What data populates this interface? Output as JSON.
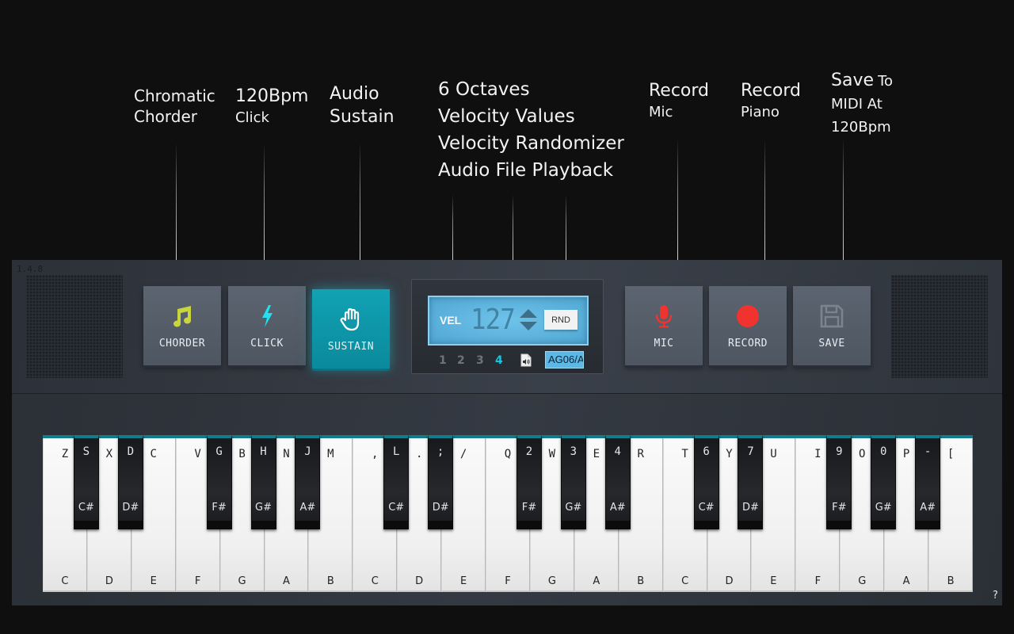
{
  "annotations": {
    "chorder": {
      "line1": "Chromatic",
      "line2": "Chorder"
    },
    "click": {
      "line1": "120Bpm",
      "line2": "Click"
    },
    "sustain": {
      "line1": "Audio",
      "line2": "Sustain"
    },
    "display": {
      "line1": "6 Octaves",
      "line2": "Velocity Values",
      "line3": "Velocity Randomizer",
      "line4": "Audio File Playback"
    },
    "mic": {
      "line1": "Record",
      "line2": "Mic"
    },
    "record": {
      "line1": "Record",
      "line2": "Piano"
    },
    "save": {
      "line1a": "Save",
      "line1b": "To",
      "line2": "MIDI At",
      "line3": "120Bpm"
    }
  },
  "version": "1.4.8",
  "buttons": {
    "chorder": {
      "label": "CHORDER",
      "icon": "music-note-icon",
      "color": "#c9d63b"
    },
    "click": {
      "label": "CLICK",
      "icon": "lightning-icon",
      "color": "#22e0f0"
    },
    "sustain": {
      "label": "SUSTAIN",
      "icon": "hand-icon",
      "active": true
    },
    "mic": {
      "label": "MIC",
      "icon": "microphone-icon",
      "color": "#f0332f"
    },
    "record": {
      "label": "RECORD",
      "icon": "record-dot-icon",
      "color": "#f0332f"
    },
    "save": {
      "label": "SAVE",
      "icon": "floppy-disk-icon",
      "color": "#7b838d"
    }
  },
  "display": {
    "vel_label": "VEL",
    "vel_value": "127",
    "rnd_label": "RND",
    "octaves": [
      "1",
      "2",
      "3",
      "4"
    ],
    "selected_octave": "4",
    "file_name": "AG06/A",
    "accent": "#16c6e0"
  },
  "keyboard": {
    "white_keys": [
      {
        "kb": "Z",
        "note": "C"
      },
      {
        "kb": "X",
        "note": "D"
      },
      {
        "kb": "C",
        "note": "E"
      },
      {
        "kb": "V",
        "note": "F"
      },
      {
        "kb": "B",
        "note": "G"
      },
      {
        "kb": "N",
        "note": "A"
      },
      {
        "kb": "M",
        "note": "B"
      },
      {
        "kb": ",",
        "note": "C"
      },
      {
        "kb": ".",
        "note": "D"
      },
      {
        "kb": "/",
        "note": "E"
      },
      {
        "kb": "Q",
        "note": "F"
      },
      {
        "kb": "W",
        "note": "G"
      },
      {
        "kb": "E",
        "note": "A"
      },
      {
        "kb": "R",
        "note": "B"
      },
      {
        "kb": "T",
        "note": "C"
      },
      {
        "kb": "Y",
        "note": "D"
      },
      {
        "kb": "U",
        "note": "E"
      },
      {
        "kb": "I",
        "note": "F"
      },
      {
        "kb": "O",
        "note": "G"
      },
      {
        "kb": "P",
        "note": "A"
      },
      {
        "kb": "[",
        "note": "B"
      }
    ],
    "black_keys": [
      {
        "kb": "S",
        "note": "C#",
        "after": 0
      },
      {
        "kb": "D",
        "note": "D#",
        "after": 1
      },
      {
        "kb": "G",
        "note": "F#",
        "after": 3
      },
      {
        "kb": "H",
        "note": "G#",
        "after": 4
      },
      {
        "kb": "J",
        "note": "A#",
        "after": 5
      },
      {
        "kb": "L",
        "note": "C#",
        "after": 7
      },
      {
        "kb": ";",
        "note": "D#",
        "after": 8
      },
      {
        "kb": "2",
        "note": "F#",
        "after": 10
      },
      {
        "kb": "3",
        "note": "G#",
        "after": 11
      },
      {
        "kb": "4",
        "note": "A#",
        "after": 12
      },
      {
        "kb": "6",
        "note": "C#",
        "after": 14
      },
      {
        "kb": "7",
        "note": "D#",
        "after": 15
      },
      {
        "kb": "9",
        "note": "F#",
        "after": 17
      },
      {
        "kb": "0",
        "note": "G#",
        "after": 18
      },
      {
        "kb": "-",
        "note": "A#",
        "after": 19
      }
    ],
    "rail_color": "#0e7d8c"
  },
  "help_label": "?"
}
